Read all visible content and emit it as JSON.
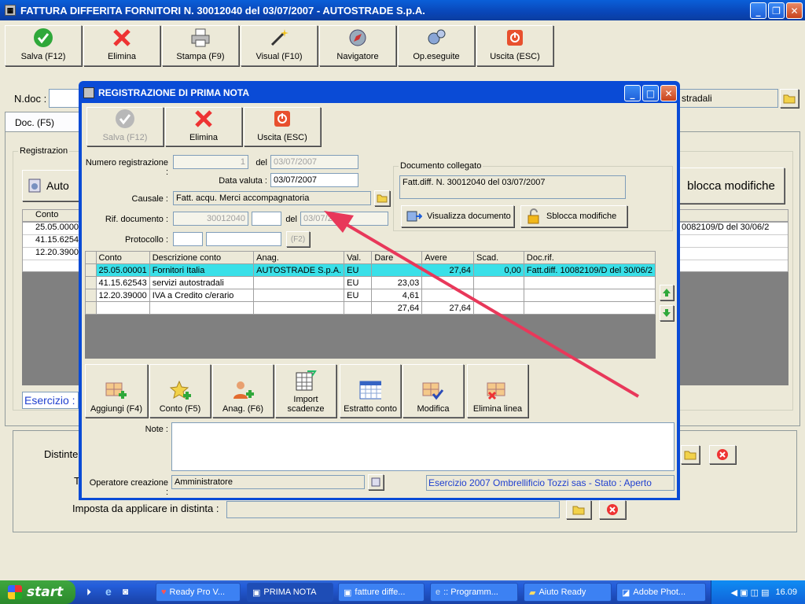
{
  "window": {
    "title": "FATTURA DIFFERITA FORNITORI N. 30012040  del 03/07/2007 - AUTOSTRADE S.p.A."
  },
  "toolbar": {
    "save": "Salva (F12)",
    "delete": "Elimina",
    "print": "Stampa (F9)",
    "visual": "Visual (F10)",
    "navigator": "Navigatore",
    "done": "Op.eseguite",
    "exit": "Uscita (ESC)"
  },
  "main": {
    "ndoc_label": "N.doc :",
    "ndoc_right": "stradali",
    "tab_doc": "Doc. (F5)",
    "group_reg": "Registrazion",
    "auto_btn": "Auto",
    "unlock_btn": "blocca modifiche",
    "grid_header_conto": "Conto",
    "rows": [
      "25.05.0000",
      "41.15.6254",
      "12.20.3900"
    ],
    "docref_right": "0082109/D del 30/06/2",
    "esercizio": "Esercizio :",
    "distinta_label": "Distinte",
    "t_label": "T",
    "imposta_label": "Imposta da applicare in distinta :"
  },
  "dialog": {
    "title": "REGISTRAZIONE DI PRIMA NOTA",
    "save": "Salva (F12)",
    "delete": "Elimina",
    "exit": "Uscita (ESC)",
    "num_reg_label": "Numero registrazione :",
    "num_reg": "1",
    "del_label": "del",
    "del_date": "03/07/2007",
    "data_valuta_label": "Data valuta :",
    "data_valuta": "03/07/2007",
    "causale_label": "Causale :",
    "causale": "Fatt. acqu. Merci accompagnatoria",
    "rif_label": "Rif. documento :",
    "rif": "30012040",
    "rif_del": "del",
    "rif_date": "03/07/2007",
    "protocollo_label": "Protocollo :",
    "f2": "(F2)",
    "doc_collegato": "Documento collegato",
    "doc_collegato_text": "Fatt.diff. N. 30012040 del 03/07/2007",
    "visualizza": "Visualizza documento",
    "sblocca": "Sblocca modifiche",
    "grid": {
      "headers": [
        "Conto",
        "Descrizione conto",
        "Anag.",
        "Val.",
        "Dare",
        "Avere",
        "Scad.",
        "Doc.rif."
      ],
      "rows": [
        [
          "25.05.00001",
          "Fornitori Italia",
          "AUTOSTRADE S.p.A.",
          "EU",
          "",
          "27,64",
          "0,00",
          "Fatt.diff. 10082109/D del 30/06/2"
        ],
        [
          "41.15.62543",
          "servizi autostradali",
          "",
          "EU",
          "23,03",
          "",
          "",
          ""
        ],
        [
          "12.20.39000",
          "IVA a Credito c/erario",
          "",
          "EU",
          "4,61",
          "",
          "",
          ""
        ],
        [
          "",
          "",
          "",
          "",
          "27,64",
          "27,64",
          "",
          ""
        ]
      ]
    },
    "actions": {
      "add": "Aggiungi (F4)",
      "account": "Conto (F5)",
      "anag": "Anag. (F6)",
      "import": "Import scadenze",
      "statement": "Estratto conto",
      "edit": "Modifica",
      "delete_line": "Elimina linea"
    },
    "note_label": "Note :",
    "operator_label": "Operatore creazione :",
    "operator": "Amministratore",
    "status": "Esercizio 2007 Ombrellificio Tozzi sas - Stato : Aperto"
  },
  "taskbar": {
    "start": "start",
    "items": [
      "Ready Pro V...",
      "PRIMA NOTA",
      "fatture diffe...",
      ":: Programm...",
      "Aiuto Ready",
      "Adobe Phot..."
    ],
    "clock": "16.09"
  },
  "colors": {
    "titlebar": "#0a4bd6",
    "selected_row": "#39e0e8",
    "status_text": "#1f3fcf",
    "arrow": "#e8385a"
  }
}
